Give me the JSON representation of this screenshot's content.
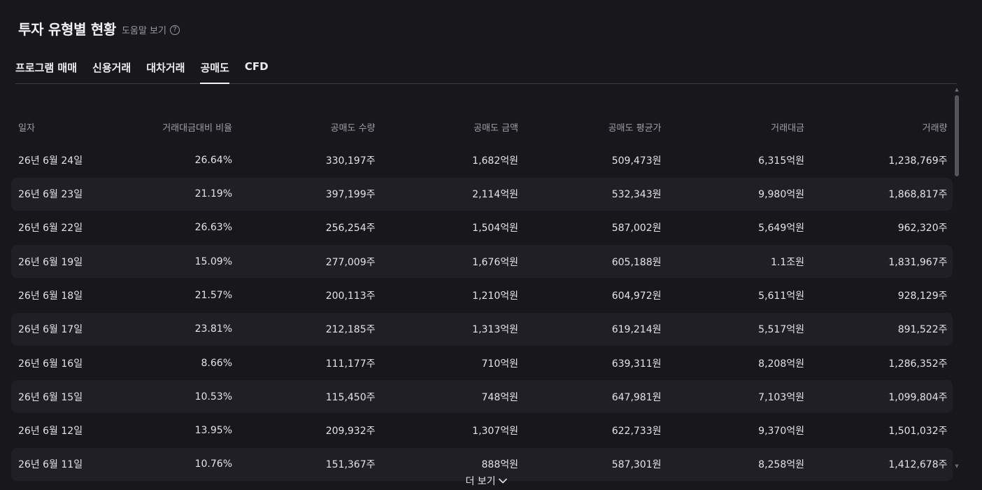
{
  "header": {
    "title": "투자 유형별 현황",
    "help_label": "도움말 보기"
  },
  "tabs": [
    {
      "label": "프로그램 매매",
      "active": false
    },
    {
      "label": "신용거래",
      "active": false
    },
    {
      "label": "대차거래",
      "active": false
    },
    {
      "label": "공매도",
      "active": true
    },
    {
      "label": "CFD",
      "active": false
    }
  ],
  "table": {
    "columns": [
      "일자",
      "거래대금대비 비율",
      "공매도 수량",
      "공매도 금액",
      "공매도 평균가",
      "거래대금",
      "거래량"
    ],
    "rows": [
      [
        "26년 6월 24일",
        "26.64%",
        "330,197주",
        "1,682억원",
        "509,473원",
        "6,315억원",
        "1,238,769주"
      ],
      [
        "26년 6월 23일",
        "21.19%",
        "397,199주",
        "2,114억원",
        "532,343원",
        "9,980억원",
        "1,868,817주"
      ],
      [
        "26년 6월 22일",
        "26.63%",
        "256,254주",
        "1,504억원",
        "587,002원",
        "5,649억원",
        "962,320주"
      ],
      [
        "26년 6월 19일",
        "15.09%",
        "277,009주",
        "1,676억원",
        "605,188원",
        "1.1조원",
        "1,831,967주"
      ],
      [
        "26년 6월 18일",
        "21.57%",
        "200,113주",
        "1,210억원",
        "604,972원",
        "5,611억원",
        "928,129주"
      ],
      [
        "26년 6월 17일",
        "23.81%",
        "212,185주",
        "1,313억원",
        "619,214원",
        "5,517억원",
        "891,522주"
      ],
      [
        "26년 6월 16일",
        "8.66%",
        "111,177주",
        "710억원",
        "639,311원",
        "8,208억원",
        "1,286,352주"
      ],
      [
        "26년 6월 15일",
        "10.53%",
        "115,450주",
        "748억원",
        "647,981원",
        "7,103억원",
        "1,099,804주"
      ],
      [
        "26년 6월 12일",
        "13.95%",
        "209,932주",
        "1,307억원",
        "622,733원",
        "9,370억원",
        "1,501,032주"
      ],
      [
        "26년 6월 11일",
        "10.76%",
        "151,367주",
        "888억원",
        "587,301원",
        "8,258억원",
        "1,412,678주"
      ]
    ]
  },
  "footer": {
    "more_label": "더 보기"
  },
  "icons": {
    "help": "question-circle-icon",
    "more": "chevron-down-icon"
  },
  "colors": {
    "background": "#17171c",
    "row_alt": "#1f1f25",
    "text": "#e4e4e8",
    "muted": "#a0a0a8"
  }
}
